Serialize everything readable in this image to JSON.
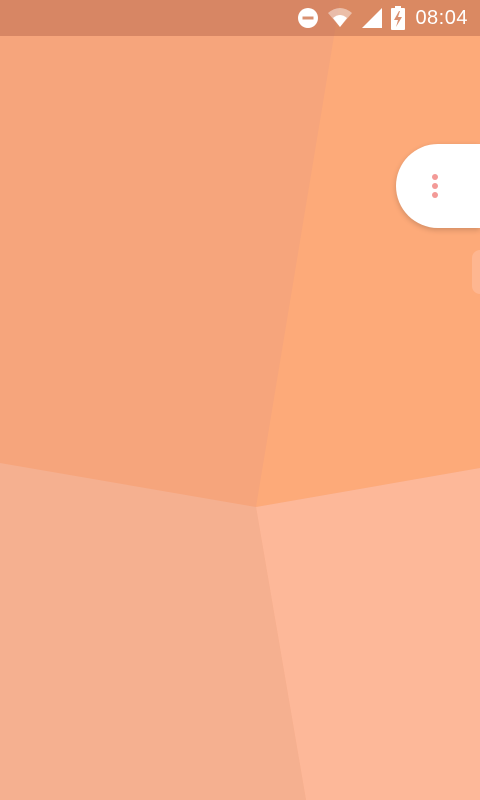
{
  "status_bar": {
    "time": "08:04",
    "icons": [
      "do-not-disturb-icon",
      "wifi-icon",
      "cellular-signal-icon",
      "battery-charging-icon"
    ]
  },
  "home": {
    "overflow_menu": {
      "icon": "more-vert-icon"
    }
  },
  "colors": {
    "wallpaper_top_left": "#f6a57c",
    "wallpaper_top_right": "#fdaa79",
    "wallpaper_bottom_left": "#f5b090",
    "wallpaper_bottom_right": "#fdb899",
    "status_bar": "#d99070",
    "menu_dots": "#f39a97"
  }
}
